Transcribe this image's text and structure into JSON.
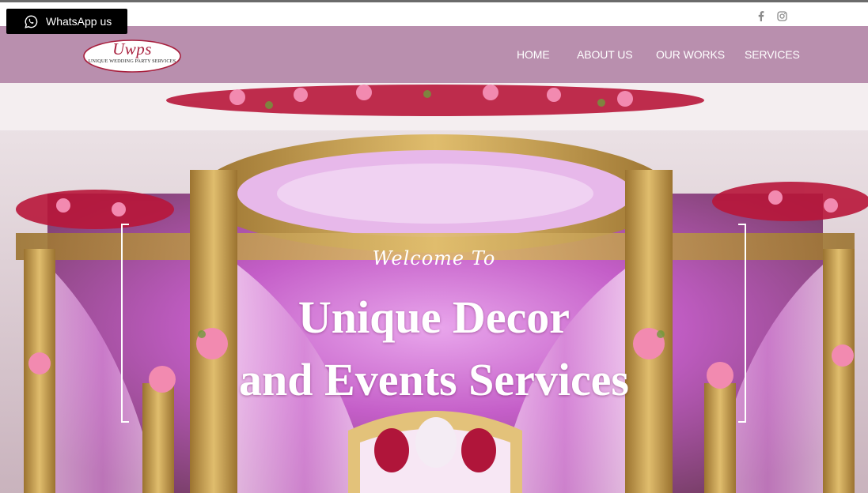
{
  "whatsapp": {
    "label": "WhatsApp us",
    "icon": "whatsapp-icon"
  },
  "social": [
    {
      "name": "facebook",
      "icon": "facebook-icon"
    },
    {
      "name": "instagram",
      "icon": "instagram-icon"
    }
  ],
  "logo": {
    "script": "Uwps",
    "subtitle": "UNIQUE WEDDING PARTY SERVICES"
  },
  "nav": [
    {
      "label": "HOME"
    },
    {
      "label": "ABOUT US"
    },
    {
      "label": "OUR WORKS"
    },
    {
      "label": "SERVICES"
    }
  ],
  "hero": {
    "welcome": "Welcome To",
    "title_line1": "Unique Decor",
    "title_line2": "and Events Services"
  },
  "colors": {
    "header_bg": "#b98fae",
    "logo_red": "#a8203e",
    "hero_purple": "#c44fc6",
    "gold": "#c9a24a"
  }
}
